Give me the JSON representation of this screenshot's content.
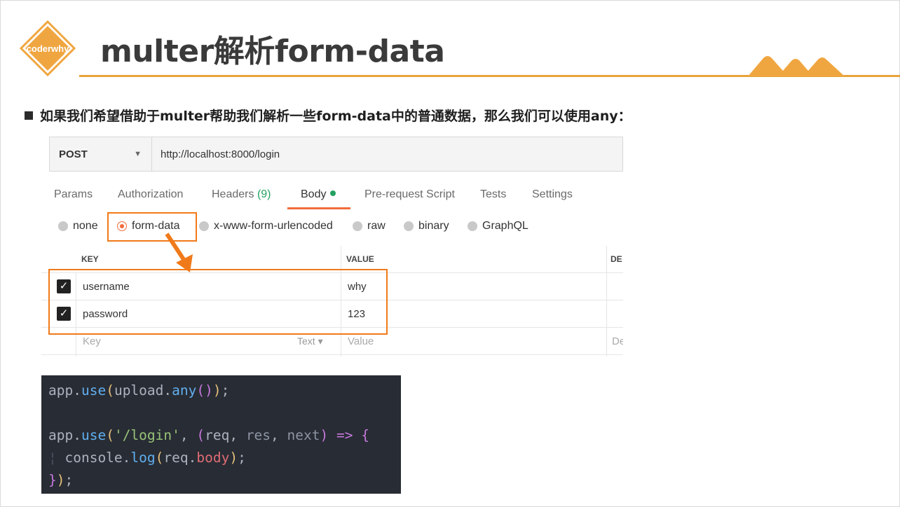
{
  "logo": {
    "text": "coderwhy"
  },
  "title": "multer解析form-data",
  "bullet": "如果我们希望借助于multer帮助我们解析一些form-data中的普通数据，那么我们可以使用any：",
  "colors": {
    "accent": "#e8a33a",
    "highlight": "#f07a1a",
    "postman_orange": "#f26b3a",
    "count_green": "#25a162",
    "code_bg": "#282c34"
  },
  "postman": {
    "method": "POST",
    "url": "http://localhost:8000/login",
    "tabs": {
      "params": "Params",
      "authorization": "Authorization",
      "headers": "Headers",
      "headers_count": "(9)",
      "body": "Body",
      "prerequest": "Pre-request Script",
      "tests": "Tests",
      "settings": "Settings"
    },
    "body_types": {
      "none": "none",
      "form_data": "form-data",
      "urlencoded": "x-www-form-urlencoded",
      "raw": "raw",
      "binary": "binary",
      "graphql": "GraphQL"
    },
    "selected_body_type": "form-data",
    "table": {
      "headers": {
        "key": "KEY",
        "value": "VALUE",
        "description": "DE"
      },
      "rows": [
        {
          "checked": true,
          "key": "username",
          "value": "why"
        },
        {
          "checked": true,
          "key": "password",
          "value": "123"
        }
      ],
      "new_row": {
        "key_placeholder": "Key",
        "type": "Text",
        "value_placeholder": "Value",
        "description_placeholder": "De"
      }
    }
  },
  "code": {
    "lines": [
      "app.use(upload.any());",
      "",
      "app.use('/login', (req, res, next) => {",
      "  console.log(req.body);",
      "});"
    ]
  }
}
